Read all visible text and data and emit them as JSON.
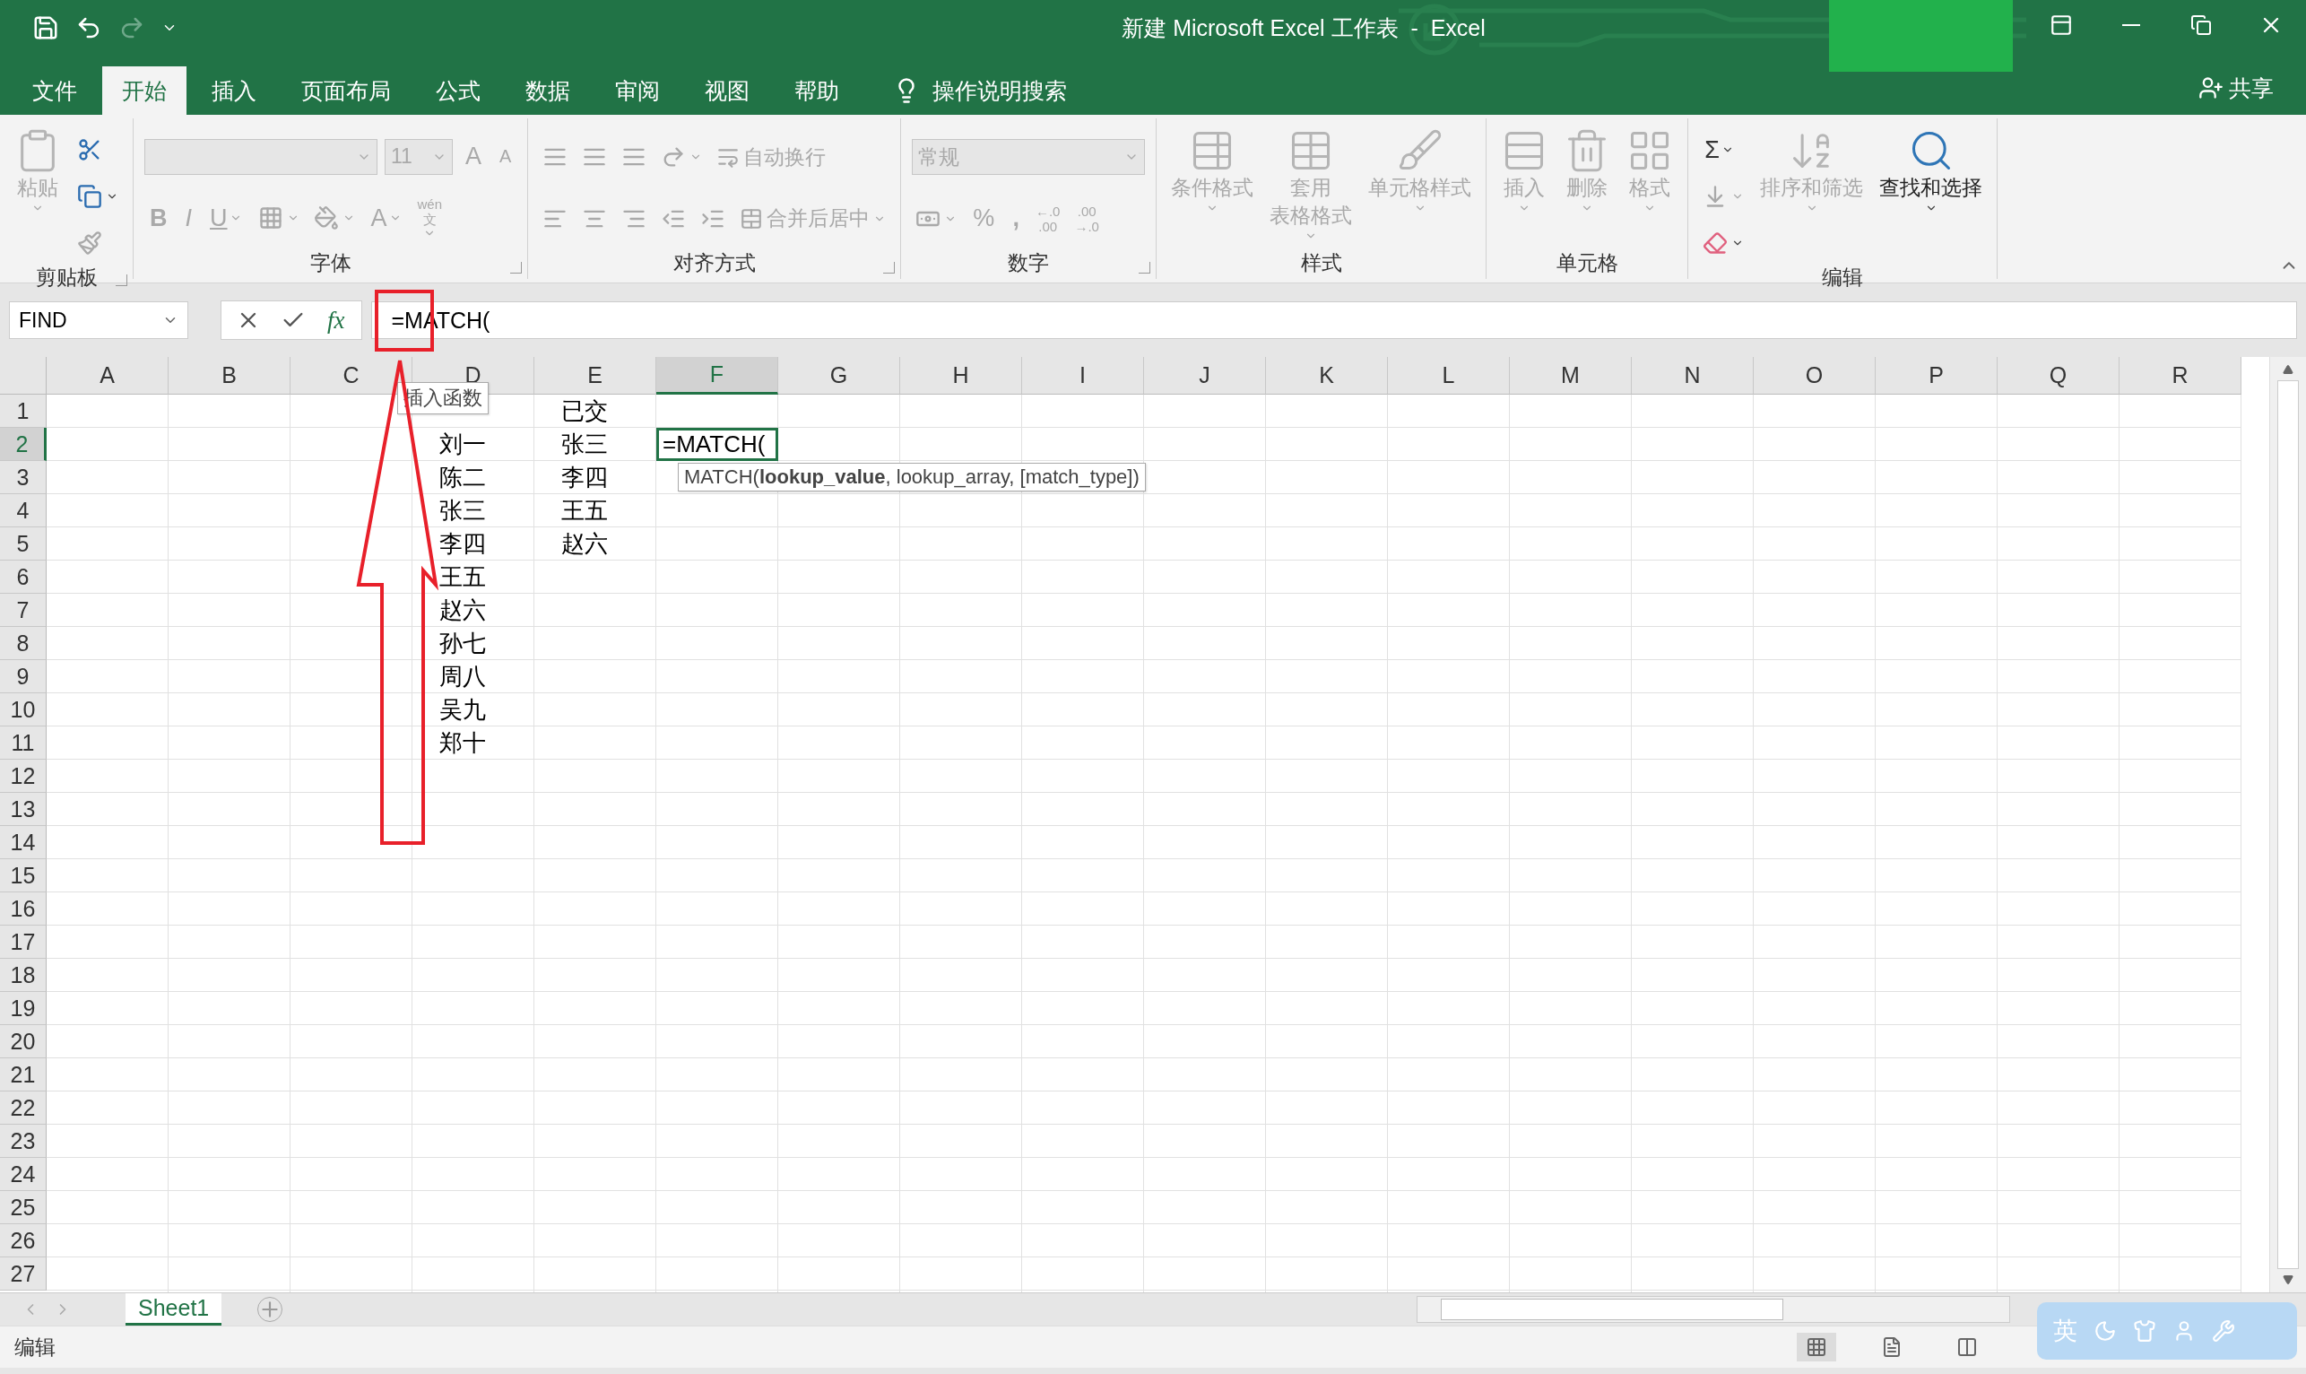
{
  "window": {
    "title": "新建 Microsoft Excel 工作表  -  Excel"
  },
  "tabs": [
    {
      "label": "文件",
      "selected": false
    },
    {
      "label": "开始",
      "selected": true
    },
    {
      "label": "插入",
      "selected": false
    },
    {
      "label": "页面布局",
      "selected": false
    },
    {
      "label": "公式",
      "selected": false
    },
    {
      "label": "数据",
      "selected": false
    },
    {
      "label": "审阅",
      "selected": false
    },
    {
      "label": "视图",
      "selected": false
    },
    {
      "label": "帮助",
      "selected": false
    }
  ],
  "tell_me": {
    "placeholder": "操作说明搜索"
  },
  "share": {
    "label": "共享"
  },
  "ribbon": [
    {
      "label": "剪贴板",
      "launcher": true,
      "blocks": [
        {
          "kind": "big",
          "lines": [
            "粘贴"
          ],
          "disabled": true,
          "dropdown": true
        },
        {
          "kind": "rows",
          "rows": [
            [
              {
                "kind": "icon",
                "disabled": false
              }
            ],
            [
              {
                "kind": "icon",
                "disabled": false,
                "dropdown": true
              }
            ],
            [
              {
                "kind": "icon",
                "disabled": true
              }
            ]
          ]
        }
      ]
    },
    {
      "label": "字体",
      "launcher": true,
      "blocks": [
        {
          "kind": "rows",
          "rows": [
            [
              {
                "kind": "combo",
                "disabled": true
              },
              {
                "kind": "combo",
                "value": "11",
                "disabled": true
              },
              {
                "kind": "glyph",
                "text": "A",
                "disabled": true
              },
              {
                "kind": "glyph",
                "text": "A",
                "disabled": true
              }
            ],
            [
              {
                "kind": "glyph",
                "text": "B",
                "disabled": true
              },
              {
                "kind": "glyph",
                "text": "I",
                "disabled": true
              },
              {
                "kind": "glyph",
                "text": "U",
                "disabled": true,
                "dropdown": true
              },
              {
                "kind": "icon",
                "disabled": true,
                "dropdown": true
              },
              {
                "kind": "icon",
                "disabled": true,
                "dropdown": true
              },
              {
                "kind": "glyph",
                "text": "A",
                "disabled": true,
                "dropdown": true
              },
              {
                "kind": "stack",
                "top": "wén",
                "bottom": "文",
                "disabled": true,
                "dropdown": true
              }
            ]
          ]
        }
      ]
    },
    {
      "label": "对齐方式",
      "launcher": true,
      "blocks": [
        {
          "kind": "rows",
          "rows": [
            [
              {
                "kind": "icon",
                "disabled": true
              },
              {
                "kind": "icon",
                "disabled": true
              },
              {
                "kind": "icon",
                "disabled": true
              },
              {
                "kind": "icon",
                "disabled": true,
                "dropdown": true
              },
              {
                "kind": "text",
                "label": "自动换行",
                "disabled": true
              }
            ],
            [
              {
                "kind": "icon",
                "disabled": true
              },
              {
                "kind": "icon",
                "disabled": true
              },
              {
                "kind": "icon",
                "disabled": true
              },
              {
                "kind": "icon",
                "disabled": true
              },
              {
                "kind": "icon",
                "disabled": true
              },
              {
                "kind": "text",
                "label": "合并后居中",
                "disabled": true,
                "dropdown": true
              }
            ]
          ]
        }
      ]
    },
    {
      "label": "数字",
      "launcher": true,
      "blocks": [
        {
          "kind": "rows",
          "rows": [
            [
              {
                "kind": "combo",
                "value": "常规",
                "disabled": true
              }
            ],
            [
              {
                "kind": "icon",
                "disabled": true,
                "dropdown": true
              },
              {
                "kind": "glyph",
                "text": "%",
                "disabled": true
              },
              {
                "kind": "glyph",
                "text": ",",
                "disabled": true
              },
              {
                "kind": "stack",
                "top": "←.0",
                "bottom": ".00",
                "disabled": true
              },
              {
                "kind": "stack",
                "top": ".00",
                "bottom": "→.0",
                "disabled": true
              }
            ]
          ]
        }
      ]
    },
    {
      "label": "样式",
      "launcher": false,
      "blocks": [
        {
          "kind": "big",
          "lines": [
            "条件格式"
          ],
          "disabled": true,
          "dropdown": true
        },
        {
          "kind": "big",
          "lines": [
            "套用",
            "表格格式"
          ],
          "disabled": true,
          "dropdown": true
        },
        {
          "kind": "big",
          "lines": [
            "单元格样式"
          ],
          "disabled": true,
          "dropdown": true
        }
      ]
    },
    {
      "label": "单元格",
      "launcher": false,
      "blocks": [
        {
          "kind": "big",
          "lines": [
            "插入"
          ],
          "disabled": true,
          "dropdown": true
        },
        {
          "kind": "big",
          "lines": [
            "删除"
          ],
          "disabled": true,
          "dropdown": true
        },
        {
          "kind": "big",
          "lines": [
            "格式"
          ],
          "disabled": true,
          "dropdown": true
        }
      ]
    },
    {
      "label": "编辑",
      "launcher": false,
      "blocks": [
        {
          "kind": "rows",
          "rows": [
            [
              {
                "kind": "glyph",
                "text": "Σ",
                "disabled": false,
                "dropdown": true
              }
            ],
            [
              {
                "kind": "icon",
                "disabled": true,
                "dropdown": true
              }
            ],
            [
              {
                "kind": "icon",
                "disabled": false,
                "dropdown": true
              }
            ]
          ]
        },
        {
          "kind": "big",
          "lines": [
            "排序和筛选"
          ],
          "disabled": true,
          "dropdown": true
        },
        {
          "kind": "big",
          "lines": [
            "查找和选择"
          ],
          "disabled": false,
          "dropdown": true
        }
      ]
    }
  ],
  "formula_bar": {
    "name_box": "FIND",
    "fx": "fx",
    "formula": "=MATCH("
  },
  "insert_function_tooltip": "插入函数",
  "formula_hint": "MATCH(**lookup_value**, lookup_array, [match_type])",
  "columns": [
    {
      "label": "A",
      "selected": false
    },
    {
      "label": "B",
      "selected": false
    },
    {
      "label": "C",
      "selected": false
    },
    {
      "label": "D",
      "selected": false
    },
    {
      "label": "E",
      "selected": false
    },
    {
      "label": "F",
      "selected": true
    },
    {
      "label": "G",
      "selected": false
    },
    {
      "label": "H",
      "selected": false
    },
    {
      "label": "I",
      "selected": false
    },
    {
      "label": "J",
      "selected": false
    },
    {
      "label": "K",
      "selected": false
    },
    {
      "label": "L",
      "selected": false
    },
    {
      "label": "M",
      "selected": false
    },
    {
      "label": "N",
      "selected": false
    },
    {
      "label": "O",
      "selected": false
    },
    {
      "label": "P",
      "selected": false
    },
    {
      "label": "Q",
      "selected": false
    },
    {
      "label": "R",
      "selected": false
    }
  ],
  "rows": [
    {
      "label": "1",
      "selected": false,
      "cells": {
        "E": "已交"
      }
    },
    {
      "label": "2",
      "selected": true,
      "cells": {
        "D": "刘一",
        "E": "张三",
        "F": "=MATCH("
      }
    },
    {
      "label": "3",
      "selected": false,
      "cells": {
        "D": "陈二",
        "E": "李四"
      }
    },
    {
      "label": "4",
      "selected": false,
      "cells": {
        "D": "张三",
        "E": "王五"
      }
    },
    {
      "label": "5",
      "selected": false,
      "cells": {
        "D": "李四",
        "E": "赵六"
      }
    },
    {
      "label": "6",
      "selected": false,
      "cells": {
        "D": "王五"
      }
    },
    {
      "label": "7",
      "selected": false,
      "cells": {
        "D": "赵六"
      }
    },
    {
      "label": "8",
      "selected": false,
      "cells": {
        "D": "孙七"
      }
    },
    {
      "label": "9",
      "selected": false,
      "cells": {
        "D": "周八"
      }
    },
    {
      "label": "10",
      "selected": false,
      "cells": {
        "D": "吴九"
      }
    },
    {
      "label": "11",
      "selected": false,
      "cells": {
        "D": "郑十"
      }
    },
    {
      "label": "12",
      "selected": false
    },
    {
      "label": "13",
      "selected": false
    },
    {
      "label": "14",
      "selected": false
    },
    {
      "label": "15",
      "selected": false
    },
    {
      "label": "16",
      "selected": false
    },
    {
      "label": "17",
      "selected": false
    },
    {
      "label": "18",
      "selected": false
    },
    {
      "label": "19",
      "selected": false
    },
    {
      "label": "20",
      "selected": false
    },
    {
      "label": "21",
      "selected": false
    },
    {
      "label": "22",
      "selected": false
    },
    {
      "label": "23",
      "selected": false
    },
    {
      "label": "24",
      "selected": false
    },
    {
      "label": "25",
      "selected": false
    },
    {
      "label": "26",
      "selected": false
    },
    {
      "label": "27",
      "selected": false
    }
  ],
  "sheets": [
    {
      "label": "Sheet1",
      "selected": true
    }
  ],
  "status_bar": {
    "mode": "编辑",
    "views": [
      {
        "selected": true
      },
      {
        "selected": false
      },
      {
        "selected": false
      }
    ]
  },
  "ime": {
    "label": "英"
  }
}
